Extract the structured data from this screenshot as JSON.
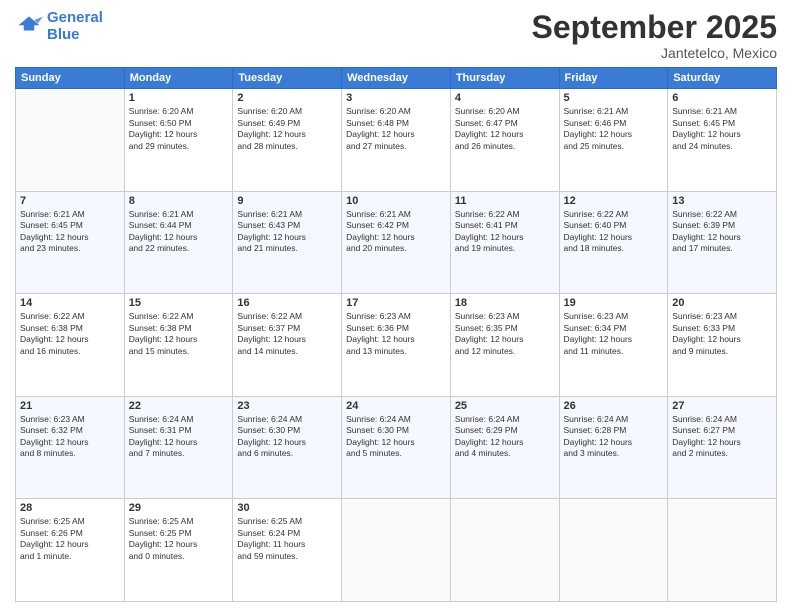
{
  "header": {
    "logo_line1": "General",
    "logo_line2": "Blue",
    "month": "September 2025",
    "location": "Jantetelco, Mexico"
  },
  "weekdays": [
    "Sunday",
    "Monday",
    "Tuesday",
    "Wednesday",
    "Thursday",
    "Friday",
    "Saturday"
  ],
  "weeks": [
    [
      {
        "day": "",
        "info": ""
      },
      {
        "day": "1",
        "info": "Sunrise: 6:20 AM\nSunset: 6:50 PM\nDaylight: 12 hours\nand 29 minutes."
      },
      {
        "day": "2",
        "info": "Sunrise: 6:20 AM\nSunset: 6:49 PM\nDaylight: 12 hours\nand 28 minutes."
      },
      {
        "day": "3",
        "info": "Sunrise: 6:20 AM\nSunset: 6:48 PM\nDaylight: 12 hours\nand 27 minutes."
      },
      {
        "day": "4",
        "info": "Sunrise: 6:20 AM\nSunset: 6:47 PM\nDaylight: 12 hours\nand 26 minutes."
      },
      {
        "day": "5",
        "info": "Sunrise: 6:21 AM\nSunset: 6:46 PM\nDaylight: 12 hours\nand 25 minutes."
      },
      {
        "day": "6",
        "info": "Sunrise: 6:21 AM\nSunset: 6:45 PM\nDaylight: 12 hours\nand 24 minutes."
      }
    ],
    [
      {
        "day": "7",
        "info": "Sunrise: 6:21 AM\nSunset: 6:45 PM\nDaylight: 12 hours\nand 23 minutes."
      },
      {
        "day": "8",
        "info": "Sunrise: 6:21 AM\nSunset: 6:44 PM\nDaylight: 12 hours\nand 22 minutes."
      },
      {
        "day": "9",
        "info": "Sunrise: 6:21 AM\nSunset: 6:43 PM\nDaylight: 12 hours\nand 21 minutes."
      },
      {
        "day": "10",
        "info": "Sunrise: 6:21 AM\nSunset: 6:42 PM\nDaylight: 12 hours\nand 20 minutes."
      },
      {
        "day": "11",
        "info": "Sunrise: 6:22 AM\nSunset: 6:41 PM\nDaylight: 12 hours\nand 19 minutes."
      },
      {
        "day": "12",
        "info": "Sunrise: 6:22 AM\nSunset: 6:40 PM\nDaylight: 12 hours\nand 18 minutes."
      },
      {
        "day": "13",
        "info": "Sunrise: 6:22 AM\nSunset: 6:39 PM\nDaylight: 12 hours\nand 17 minutes."
      }
    ],
    [
      {
        "day": "14",
        "info": "Sunrise: 6:22 AM\nSunset: 6:38 PM\nDaylight: 12 hours\nand 16 minutes."
      },
      {
        "day": "15",
        "info": "Sunrise: 6:22 AM\nSunset: 6:38 PM\nDaylight: 12 hours\nand 15 minutes."
      },
      {
        "day": "16",
        "info": "Sunrise: 6:22 AM\nSunset: 6:37 PM\nDaylight: 12 hours\nand 14 minutes."
      },
      {
        "day": "17",
        "info": "Sunrise: 6:23 AM\nSunset: 6:36 PM\nDaylight: 12 hours\nand 13 minutes."
      },
      {
        "day": "18",
        "info": "Sunrise: 6:23 AM\nSunset: 6:35 PM\nDaylight: 12 hours\nand 12 minutes."
      },
      {
        "day": "19",
        "info": "Sunrise: 6:23 AM\nSunset: 6:34 PM\nDaylight: 12 hours\nand 11 minutes."
      },
      {
        "day": "20",
        "info": "Sunrise: 6:23 AM\nSunset: 6:33 PM\nDaylight: 12 hours\nand 9 minutes."
      }
    ],
    [
      {
        "day": "21",
        "info": "Sunrise: 6:23 AM\nSunset: 6:32 PM\nDaylight: 12 hours\nand 8 minutes."
      },
      {
        "day": "22",
        "info": "Sunrise: 6:24 AM\nSunset: 6:31 PM\nDaylight: 12 hours\nand 7 minutes."
      },
      {
        "day": "23",
        "info": "Sunrise: 6:24 AM\nSunset: 6:30 PM\nDaylight: 12 hours\nand 6 minutes."
      },
      {
        "day": "24",
        "info": "Sunrise: 6:24 AM\nSunset: 6:30 PM\nDaylight: 12 hours\nand 5 minutes."
      },
      {
        "day": "25",
        "info": "Sunrise: 6:24 AM\nSunset: 6:29 PM\nDaylight: 12 hours\nand 4 minutes."
      },
      {
        "day": "26",
        "info": "Sunrise: 6:24 AM\nSunset: 6:28 PM\nDaylight: 12 hours\nand 3 minutes."
      },
      {
        "day": "27",
        "info": "Sunrise: 6:24 AM\nSunset: 6:27 PM\nDaylight: 12 hours\nand 2 minutes."
      }
    ],
    [
      {
        "day": "28",
        "info": "Sunrise: 6:25 AM\nSunset: 6:26 PM\nDaylight: 12 hours\nand 1 minute."
      },
      {
        "day": "29",
        "info": "Sunrise: 6:25 AM\nSunset: 6:25 PM\nDaylight: 12 hours\nand 0 minutes."
      },
      {
        "day": "30",
        "info": "Sunrise: 6:25 AM\nSunset: 6:24 PM\nDaylight: 11 hours\nand 59 minutes."
      },
      {
        "day": "",
        "info": ""
      },
      {
        "day": "",
        "info": ""
      },
      {
        "day": "",
        "info": ""
      },
      {
        "day": "",
        "info": ""
      }
    ]
  ]
}
